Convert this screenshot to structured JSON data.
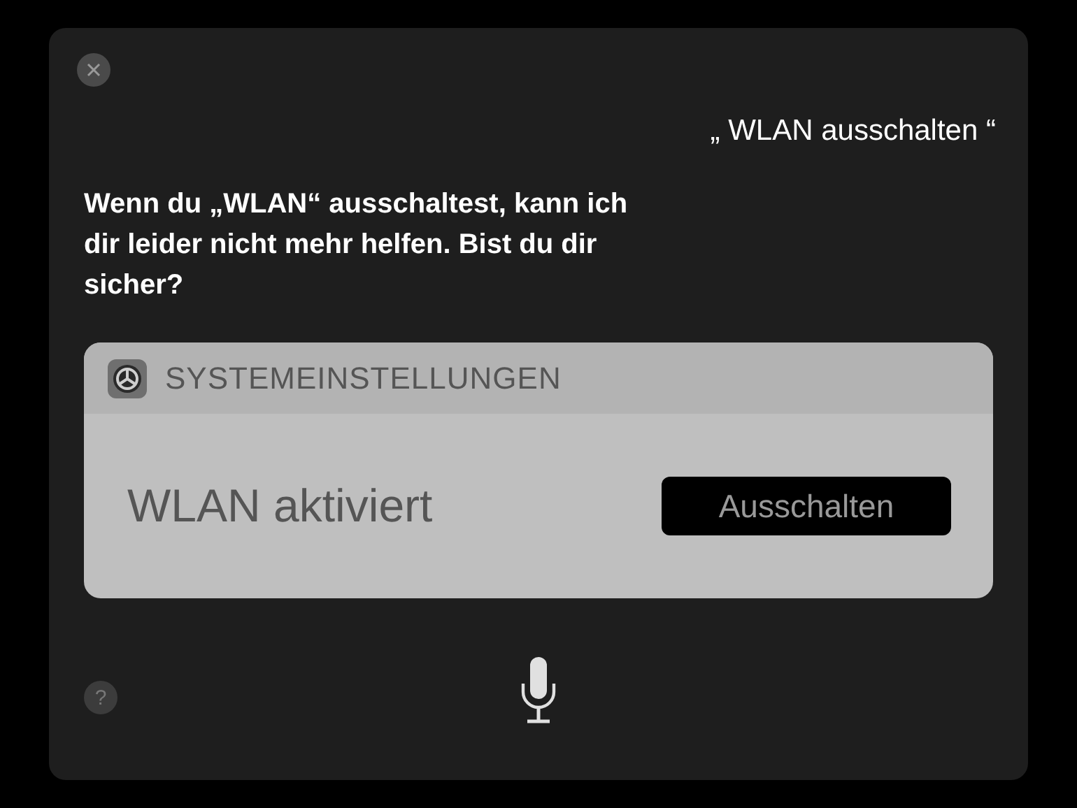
{
  "query": "„ WLAN ausschalten “",
  "response": "Wenn du „WLAN“ ausschaltest, kann ich dir leider nicht mehr helfen. Bist du dir sicher?",
  "card": {
    "app_name": "SYSTEMEINSTELLUNGEN",
    "status": "WLAN aktiviert",
    "button": "Ausschalten"
  },
  "help": "?"
}
